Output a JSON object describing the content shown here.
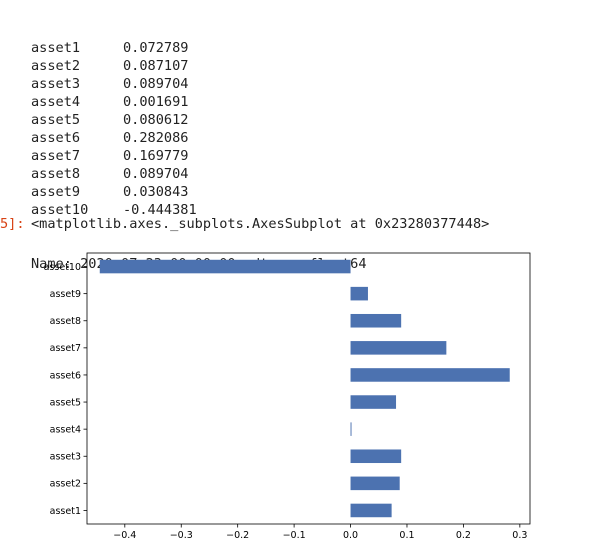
{
  "series_output": {
    "rows": [
      {
        "name": "asset1",
        "value": "0.072789"
      },
      {
        "name": "asset2",
        "value": "0.087107"
      },
      {
        "name": "asset3",
        "value": "0.089704"
      },
      {
        "name": "asset4",
        "value": "0.001691"
      },
      {
        "name": "asset5",
        "value": "0.080612"
      },
      {
        "name": "asset6",
        "value": "0.282086"
      },
      {
        "name": "asset7",
        "value": "0.169779"
      },
      {
        "name": "asset8",
        "value": "0.089704"
      },
      {
        "name": "asset9",
        "value": "0.030843"
      },
      {
        "name": "asset10",
        "value": "-0.444381"
      }
    ],
    "footer": "Name: 2020-07-23 00:00:00, dtype: float64"
  },
  "out_cell": {
    "prompt": "5]:",
    "repr": "<matplotlib.axes._subplots.AxesSubplot at 0x23280377448>"
  },
  "colors": {
    "bar": "#4c72b0",
    "prompt": "#d84315",
    "text": "#222222"
  },
  "chart_data": {
    "type": "bar",
    "orientation": "horizontal",
    "categories": [
      "asset1",
      "asset2",
      "asset3",
      "asset4",
      "asset5",
      "asset6",
      "asset7",
      "asset8",
      "asset9",
      "asset10"
    ],
    "values": [
      0.072789,
      0.087107,
      0.089704,
      0.001691,
      0.080612,
      0.282086,
      0.169779,
      0.089704,
      0.030843,
      -0.444381
    ],
    "xlim": [
      -0.467,
      0.318
    ],
    "xticks": [
      -0.4,
      -0.3,
      -0.2,
      -0.1,
      0.0,
      0.1,
      0.2,
      0.3
    ],
    "xtick_labels": [
      "−0.4",
      "−0.3",
      "−0.2",
      "−0.1",
      "0.0",
      "0.1",
      "0.2",
      "0.3"
    ],
    "grid": false,
    "legend": false
  }
}
